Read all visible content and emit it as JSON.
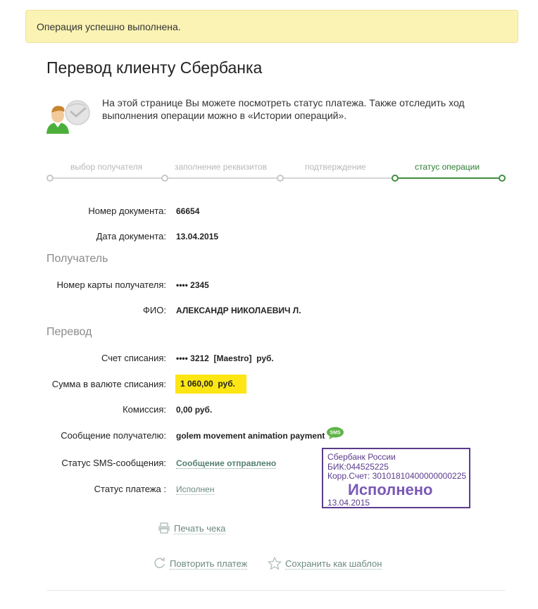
{
  "alert": {
    "message": "Операция успешно выполнена."
  },
  "title": "Перевод клиенту Сбербанка",
  "intro": "На этой странице Вы можете посмотреть статус платежа. Также отследить ход выполнения операции можно в «Истории операций».",
  "steps": [
    {
      "label": "выбор получателя",
      "active": false
    },
    {
      "label": "заполнение реквизитов",
      "active": false
    },
    {
      "label": "подтверждение",
      "active": false
    },
    {
      "label": "статус операции",
      "active": true
    }
  ],
  "document": {
    "number_label": "Номер документа:",
    "number": "66654",
    "date_label": "Дата документа:",
    "date": "13.04.2015"
  },
  "recipient": {
    "section_title": "Получатель",
    "card_label": "Номер карты получателя:",
    "card": "•••• 2345",
    "name_label": "ФИО:",
    "name": "АЛЕКСАНДР НИКОЛАЕВИЧ Л."
  },
  "transfer": {
    "section_title": "Перевод",
    "account_label": "Счет списания:",
    "account": "•••• 3212  [Maestro]  руб.",
    "amount_label": "Сумма в валюте списания:",
    "amount": "1 060,00  руб.",
    "fee_label": "Комиссия:",
    "fee": "0,00 руб.",
    "message_label": "Сообщение получателю:",
    "message": "golem movement animation payment",
    "sms_status_label": "Статус SMS-сообщения:",
    "sms_status": "Сообщение отправлено",
    "payment_status_label": "Статус платежа :",
    "payment_status": "Исполнен"
  },
  "stamp": {
    "bank": "Сбербанк России",
    "bik": "БИК:044525225",
    "corr": "Корр.Счет: 30101810400000000225",
    "status": "Исполнено",
    "date": "13.04.2015"
  },
  "actions": {
    "print": "Печать чека",
    "repeat": "Повторить платеж",
    "save_template": "Сохранить как шаблон"
  },
  "icons": {
    "sms": "sms-bubble-icon",
    "print": "printer-icon",
    "repeat": "refresh-icon",
    "save": "star-icon"
  },
  "colors": {
    "accent_green": "#3f8f3f",
    "highlight_yellow": "#fde613",
    "stamp_purple": "#5b3b8c"
  }
}
